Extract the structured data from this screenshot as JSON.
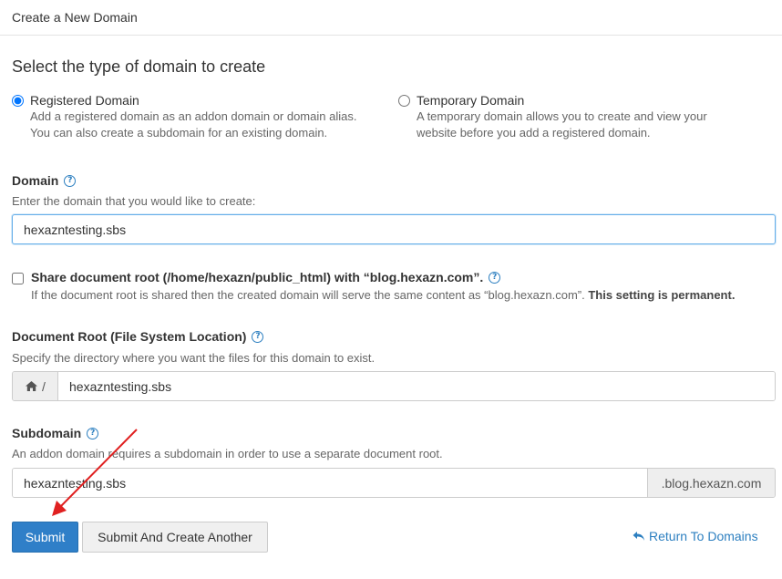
{
  "header": {
    "title": "Create a New Domain"
  },
  "section": {
    "title": "Select the type of domain to create"
  },
  "domain_types": [
    {
      "label": "Registered Domain",
      "desc_line1": "Add a registered domain as an addon domain or domain alias.",
      "desc_line2": "You can also create a subdomain for an existing domain.",
      "selected": true
    },
    {
      "label": "Temporary Domain",
      "desc_line1": "A temporary domain allows you to create and view your",
      "desc_line2": "website before you add a registered domain.",
      "selected": false
    }
  ],
  "domain": {
    "label": "Domain",
    "help": "Enter the domain that you would like to create:",
    "value": "hexazntesting.sbs"
  },
  "share_root": {
    "label": "Share document root (/home/hexazn/public_html) with “blog.hexazn.com”.",
    "desc": "If the document root is shared then the created domain will serve the same content as “blog.hexazn.com”.",
    "desc_strong": "This setting is permanent.",
    "checked": false
  },
  "document_root": {
    "label": "Document Root (File System Location)",
    "help": "Specify the directory where you want the files for this domain to exist.",
    "prefix": "/",
    "value": "hexazntesting.sbs"
  },
  "subdomain": {
    "label": "Subdomain",
    "help": "An addon domain requires a subdomain in order to use a separate document root.",
    "value": "hexazntesting.sbs",
    "suffix": ".blog.hexazn.com"
  },
  "actions": {
    "submit": "Submit",
    "submit_another": "Submit And Create Another",
    "return": "Return To Domains"
  },
  "colors": {
    "accent": "#2f7fc8",
    "link": "#2c7fc0",
    "annotation_arrow": "#e02020"
  },
  "icons": {
    "help": "question-circle-icon",
    "home": "home-icon",
    "return": "reply-arrow-icon"
  }
}
